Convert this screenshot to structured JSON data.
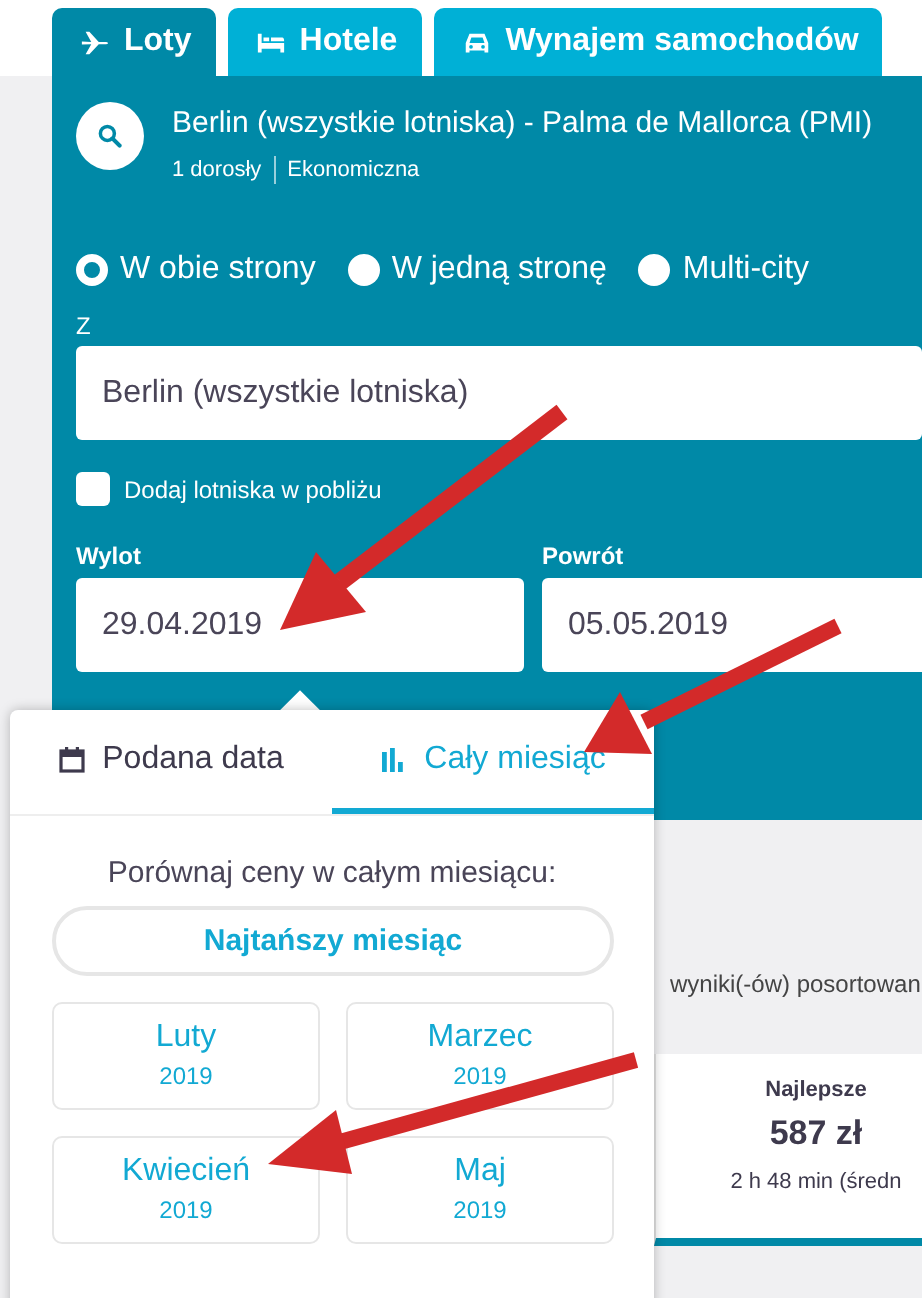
{
  "tabs": [
    {
      "label": "Loty",
      "selected": true
    },
    {
      "label": "Hotele",
      "selected": false
    },
    {
      "label": "Wynajem samochodów",
      "selected": false
    }
  ],
  "search_summary": {
    "route": "Berlin (wszystkie lotniska) - Palma de Mallorca (PMI)",
    "passengers": "1 dorosły",
    "cabin": "Ekonomiczna"
  },
  "trip_types": [
    {
      "label": "W obie strony",
      "selected": true
    },
    {
      "label": "W jedną stronę",
      "selected": false
    },
    {
      "label": "Multi-city",
      "selected": false
    }
  ],
  "from": {
    "label": "Z",
    "value": "Berlin (wszystkie lotniska)"
  },
  "nearby_airports": {
    "label": "Dodaj lotniska w pobliżu",
    "checked": false
  },
  "dates": [
    {
      "label": "Wylot",
      "value": "29.04.2019"
    },
    {
      "label": "Powrót",
      "value": "05.05.2019"
    }
  ],
  "date_popup": {
    "tabs": [
      {
        "label": "Podana data",
        "selected": false
      },
      {
        "label": "Cały miesiąc",
        "selected": true
      }
    ],
    "prompt": "Porównaj ceny w całym miesiącu:",
    "cheapest_button": "Najtańszy miesiąc",
    "months": [
      {
        "name": "Luty",
        "year": "2019"
      },
      {
        "name": "Marzec",
        "year": "2019"
      },
      {
        "name": "Kwiecień",
        "year": "2019"
      },
      {
        "name": "Maj",
        "year": "2019"
      }
    ]
  },
  "results": {
    "summary": "wyniki(-ów) posortowan",
    "best": {
      "label": "Najlepsze",
      "price": "587 zł",
      "duration": "2 h 48 min (średn"
    }
  }
}
